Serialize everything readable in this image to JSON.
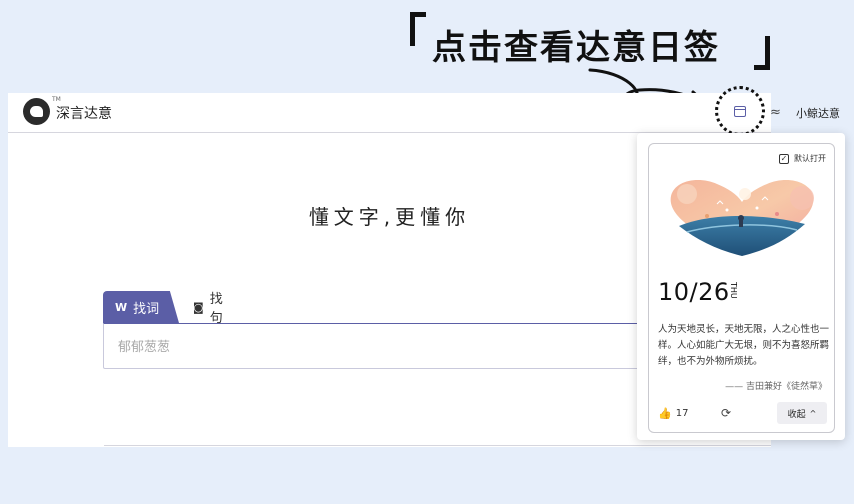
{
  "callout": {
    "text": "点击查看达意日签"
  },
  "header": {
    "brand": "深言达意",
    "tm": "TM",
    "user_name": "小鲸达意",
    "user_avatar_icon": "whale-icon",
    "calendar_icon": "calendar-icon"
  },
  "main": {
    "slogan": "懂文字,更懂你"
  },
  "tabs": [
    {
      "label": "找词",
      "icon": "W"
    },
    {
      "label": "找句",
      "icon": "◙"
    }
  ],
  "search": {
    "placeholder": "郁郁葱葱"
  },
  "daily_card": {
    "default_open_label": "默认打开",
    "default_open_checked": true,
    "date": "10/26",
    "weekday": "THU",
    "quote": "人为天地灵长，天地无限，人之心性也一样。人心如能广大无垠，则不为喜怒所羁绊，也不为外物所烦扰。",
    "source": "—— 吉田兼好《徒然草》",
    "like_count": "17",
    "collapse_label": "收起",
    "accent_color": "#5b5ea6"
  }
}
